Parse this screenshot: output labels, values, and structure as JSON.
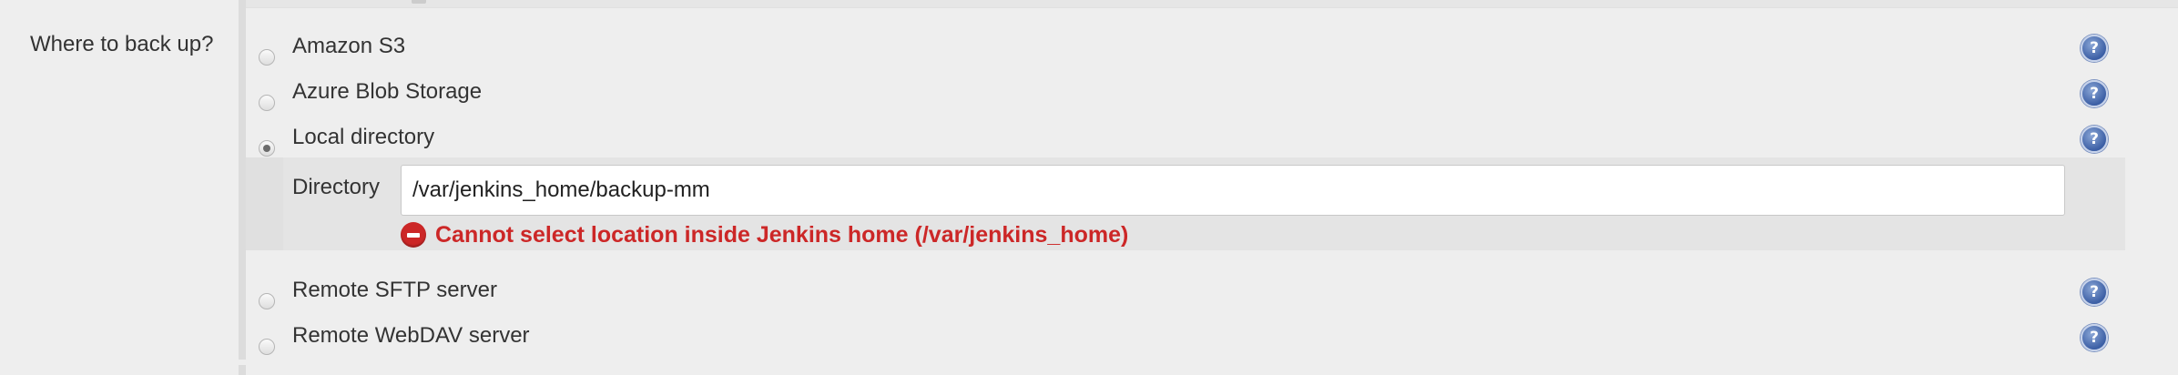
{
  "field": {
    "label": "Where to back up?"
  },
  "options": [
    {
      "label": "Amazon S3",
      "selected": false,
      "help_icon": "help-icon"
    },
    {
      "label": "Azure Blob Storage",
      "selected": false,
      "help_icon": "help-icon"
    },
    {
      "label": "Local directory",
      "selected": true,
      "help_icon": "help-icon"
    },
    {
      "label": "Remote SFTP server",
      "selected": false,
      "help_icon": "help-icon"
    },
    {
      "label": "Remote WebDAV server",
      "selected": false,
      "help_icon": "help-icon"
    }
  ],
  "local_directory": {
    "label": "Directory",
    "value": "/var/jenkins_home/backup-mm",
    "error": "Cannot select location inside Jenkins home (/var/jenkins_home)"
  },
  "help_glyph": "?",
  "colors": {
    "error": "#cc2727",
    "help": "#3c5fa5",
    "background": "#eeeeee"
  }
}
